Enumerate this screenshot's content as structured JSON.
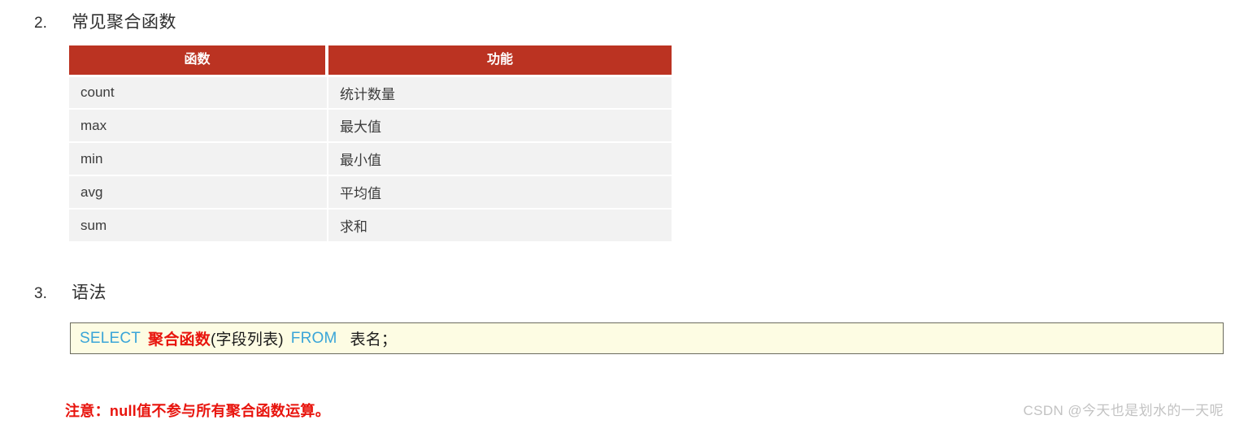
{
  "sections": [
    {
      "number": "2.",
      "title": "常见聚合函数"
    },
    {
      "number": "3.",
      "title": "语法"
    }
  ],
  "table": {
    "headers": [
      "函数",
      "功能"
    ],
    "rows": [
      {
        "function": "count",
        "description": "统计数量"
      },
      {
        "function": "max",
        "description": "最大值"
      },
      {
        "function": "min",
        "description": "最小值"
      },
      {
        "function": "avg",
        "description": "平均值"
      },
      {
        "function": "sum",
        "description": "求和"
      }
    ],
    "header_bg_color": "#bb3322",
    "row_bg_color": "#f2f2f2"
  },
  "code_block": {
    "full_text": "SELECT 聚合函数(字段列表) FROM  表名；",
    "tokens": {
      "select": "SELECT",
      "aggregate_function": "聚合函数",
      "field_list": "(字段列表)",
      "from": "FROM",
      "table_name": "表名；"
    },
    "keyword_color": "#3aa5d8",
    "highlight_color": "#e8140d",
    "background_color": "#fdfce3"
  },
  "note": {
    "text": "注意：null值不参与所有聚合函数运算。",
    "color": "#e8140d"
  },
  "watermark": {
    "text": "CSDN @今天也是划水的一天呢"
  }
}
